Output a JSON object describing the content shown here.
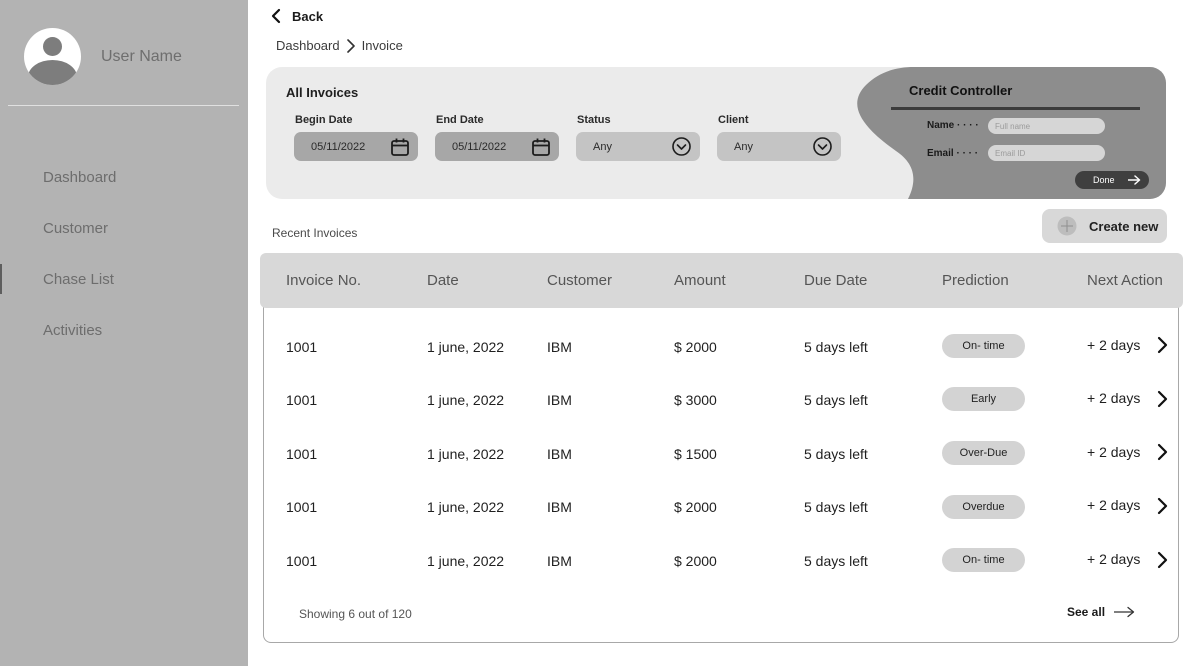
{
  "sidebar": {
    "user_name": "User Name",
    "items": [
      {
        "label": "Dashboard"
      },
      {
        "label": "Customer"
      },
      {
        "label": "Chase List"
      },
      {
        "label": "Activities"
      }
    ]
  },
  "header": {
    "back_label": "Back",
    "breadcrumb": [
      "Dashboard",
      "Invoice"
    ]
  },
  "filters": {
    "title": "All Invoices",
    "begin_date": {
      "label": "Begin Date",
      "value": "05/11/2022"
    },
    "end_date": {
      "label": "End Date",
      "value": "05/11/2022"
    },
    "status": {
      "label": "Status",
      "value": "Any"
    },
    "client": {
      "label": "Client",
      "value": "Any"
    }
  },
  "credit_controller": {
    "title": "Credit Controller",
    "name_label": "Name · · · ·",
    "name_placeholder": "Full name",
    "email_label": "Email · · · ·",
    "email_placeholder": "Email ID",
    "done_label": "Done"
  },
  "recent": {
    "label": "Recent Invoices",
    "create_label": "Create new"
  },
  "table": {
    "columns": [
      "Invoice No.",
      "Date",
      "Customer",
      "Amount",
      "Due Date",
      "Prediction",
      "Next Action"
    ],
    "rows": [
      {
        "invoice": "1001",
        "date": "1 june, 2022",
        "customer": "IBM",
        "amount": "$ 2000",
        "due": "5 days left",
        "prediction": "On- time",
        "next": "+ 2 days"
      },
      {
        "invoice": "1001",
        "date": "1 june, 2022",
        "customer": "IBM",
        "amount": "$ 3000",
        "due": "5 days left",
        "prediction": "Early",
        "next": "+ 2 days"
      },
      {
        "invoice": "1001",
        "date": "1 june, 2022",
        "customer": "IBM",
        "amount": "$ 1500",
        "due": "5 days left",
        "prediction": "Over-Due",
        "next": "+ 2 days"
      },
      {
        "invoice": "1001",
        "date": "1 june, 2022",
        "customer": "IBM",
        "amount": "$ 2000",
        "due": "5 days left",
        "prediction": "Overdue",
        "next": "+ 2 days"
      },
      {
        "invoice": "1001",
        "date": "1 june, 2022",
        "customer": "IBM",
        "amount": "$ 2000",
        "due": "5 days left",
        "prediction": "On- time",
        "next": "+ 2 days"
      }
    ],
    "showing": "Showing 6 out of 120",
    "see_all": "See all"
  }
}
